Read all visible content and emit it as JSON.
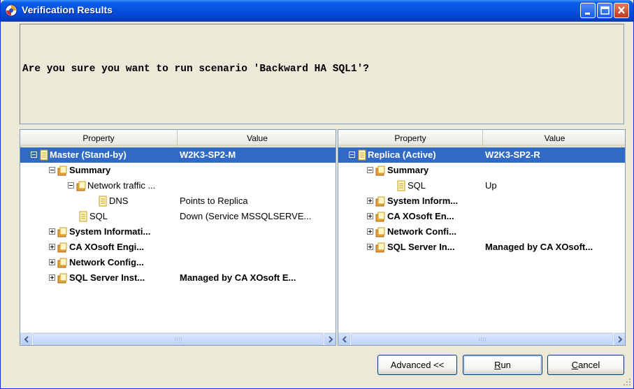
{
  "window": {
    "title": "Verification Results"
  },
  "question": "Are you sure you want to run scenario 'Backward HA SQL1'?",
  "left_panel": {
    "headers": {
      "property": "Property",
      "value": "Value"
    },
    "rows": [
      {
        "property": "Master (Stand-by)",
        "value": "W2K3-SP2-M"
      },
      {
        "property": "Summary",
        "value": ""
      },
      {
        "property": "Network traffic ...",
        "value": ""
      },
      {
        "property": "DNS",
        "value": "Points to Replica"
      },
      {
        "property": "SQL",
        "value": "Down (Service MSSQLSERVE..."
      },
      {
        "property": "System Informati...",
        "value": ""
      },
      {
        "property": "CA XOsoft Engi...",
        "value": ""
      },
      {
        "property": "Network Config...",
        "value": ""
      },
      {
        "property": "SQL Server Inst...",
        "value": "Managed by CA XOsoft E..."
      }
    ]
  },
  "right_panel": {
    "headers": {
      "property": "Property",
      "value": "Value"
    },
    "rows": [
      {
        "property": "Replica (Active)",
        "value": "W2K3-SP2-R"
      },
      {
        "property": "Summary",
        "value": ""
      },
      {
        "property": "SQL",
        "value": "Up"
      },
      {
        "property": "System Inform...",
        "value": ""
      },
      {
        "property": "CA XOsoft En...",
        "value": ""
      },
      {
        "property": "Network Confi...",
        "value": ""
      },
      {
        "property": "SQL Server In...",
        "value": "Managed by CA XOsoft..."
      }
    ]
  },
  "buttons": {
    "advanced": "Advanced <<",
    "run_rest": "un",
    "run_key": "R",
    "cancel_key": "C",
    "cancel_rest": "ancel"
  },
  "colors": {
    "selection": "#316ac5",
    "titlebar": "#0550df",
    "dialog_bg": "#ece9d8"
  },
  "icons": [
    "app-icon",
    "minimize-icon",
    "maximize-icon",
    "close-icon",
    "property-page-icon",
    "property-folder-icon",
    "scroll-left-icon",
    "scroll-right-icon"
  ]
}
